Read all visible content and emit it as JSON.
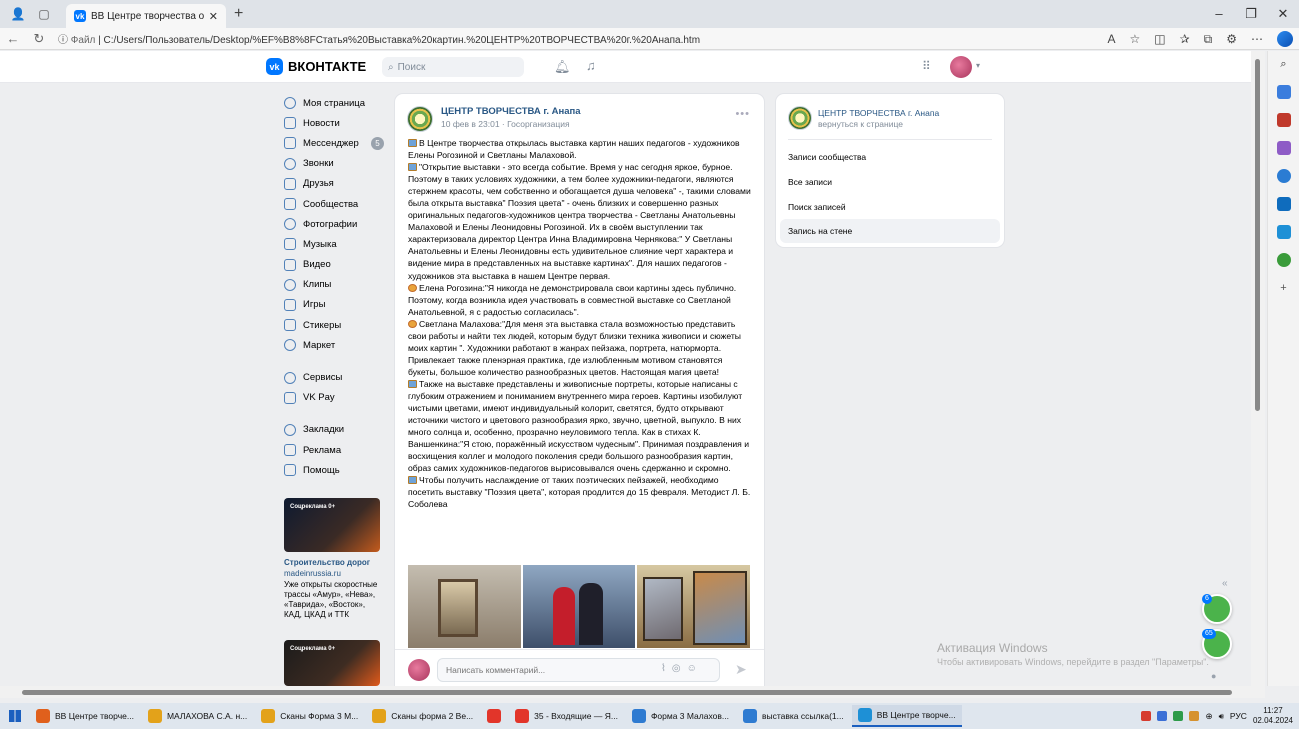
{
  "browser": {
    "tab_title": "ВВ Центре творчества откры",
    "address_label": "Файл",
    "url": "C:/Users/Пользователь/Desktop/%EF%B8%8FСтатья%20Выставка%20картин.%20ЦЕНТР%20ТВОРЧЕСТВА%20г.%20Анапа.htm"
  },
  "vk": {
    "logo_text": "ВКОНТАКТЕ",
    "search_placeholder": "Поиск"
  },
  "menu": {
    "group1": [
      {
        "label": "Моя страница",
        "icon": "user-icon"
      },
      {
        "label": "Новости",
        "icon": "news-icon"
      },
      {
        "label": "Мессенджер",
        "icon": "message-icon",
        "badge": "5"
      },
      {
        "label": "Звонки",
        "icon": "phone-icon"
      },
      {
        "label": "Друзья",
        "icon": "friends-icon"
      },
      {
        "label": "Сообщества",
        "icon": "groups-icon"
      },
      {
        "label": "Фотографии",
        "icon": "photo-icon"
      },
      {
        "label": "Музыка",
        "icon": "music-icon"
      },
      {
        "label": "Видео",
        "icon": "video-icon"
      },
      {
        "label": "Клипы",
        "icon": "clips-icon"
      },
      {
        "label": "Игры",
        "icon": "games-icon"
      },
      {
        "label": "Стикеры",
        "icon": "stickers-icon"
      },
      {
        "label": "Маркет",
        "icon": "market-icon"
      }
    ],
    "group2": [
      {
        "label": "Сервисы",
        "icon": "services-icon"
      },
      {
        "label": "VK Pay",
        "icon": "vkpay-icon"
      }
    ],
    "group3": [
      {
        "label": "Закладки",
        "icon": "bookmark-icon"
      },
      {
        "label": "Реклама",
        "icon": "ads-icon"
      },
      {
        "label": "Помощь",
        "icon": "help-icon"
      }
    ]
  },
  "ad": {
    "tag": "Соцреклама 0+",
    "title": "Строительство дорог",
    "site": "madeinrussia.ru",
    "text": "Уже открыты скоростные трассы «Амур», «Нева», «Таврида», «Восток», КАД, ЦКАД и ТТК",
    "tag2": "Соцреклама 0+"
  },
  "post": {
    "author": "ЦЕНТР ТВОРЧЕСТВА г. Анапа",
    "meta": "10 фев в 23:01 · Госорганизация",
    "paragraphs": [
      "В Центре творчества открылась выставка картин наших педагогов - художников Елены Рогозиной и Светланы Малаховой.",
      "\"Открытие выставки - это всегда событие. Время у нас сегодня яркое, бурное. Поэтому в таких условиях художники, а тем более художники-педагоги, являются стержнем красоты, чем собственно и обогащается душа человека\" -, такими словами была открыта выставка\" Поэзия цвета\" - очень близких и совершенно разных оригинальных педагогов-художников центра творчества - Светланы Анатольевны Малаховой и Елены Леонидовны Рогозиной. Их в своём выступлении так характеризовала директор Центра Инна Владимировна Чернякова:\" У Светланы Анатольевны и Елены Леонидовны есть удивительное слияние черт характера и видение мира в представленных на выставке картинах\". Для наших педагогов - художников эта выставка в нашем Центре первая.",
      "Елена Рогозина:\"Я никогда не демонстрировала свои картины здесь публично. Поэтому, когда возникла идея участвовать в совместной выставке со Светланой Анатольевной, я с радостью согласилась\".",
      "Светлана Малахова:\"Для меня эта выставка стала возможностью представить свои работы и найти тех людей, которым будут близки техника живописи и сюжеты моих картин \". Художники работают в жанрах пейзажа, портрета, натюрморта. Привлекает также пленэрная практика, где излюбленным мотивом становятся букеты, большое количество разнообразных цветов. Настоящая магия цвета!",
      "Также на выставке представлены и живописные портреты, которые написаны с глубоким отражением и пониманием внутреннего мира героев. Картины изобилуют чистыми цветами, имеют индивидуальный колорит, светятся, будто открывают источники чистого и цветового разнообразия ярко, звучно, цветной, выпукло. В них много солнца и, особенно, прозрачно неуловимого тепла. Как в стихах К. Ваншенкина:\"Я стою, поражённый искусством чудесным\". Принимая поздравления и восхищения коллег и молодого поколения среди большого разнообразия картин, образ самих художников-педагогов вырисовывался очень сдержанно и скромно.",
      "Чтобы получить наслаждение от таких поэтических пейзажей, необходимо посетить выставку \"Поэзия цвета\", которая продлится до 15 февраля. Методист Л. Б. Соболева"
    ],
    "comment_placeholder": "Написать комментарий..."
  },
  "right": {
    "name": "ЦЕНТР ТВОРЧЕСТВА г. Анапа",
    "back": "вернуться к странице",
    "items": [
      "Записи сообщества",
      "Все записи",
      "Поиск записей",
      "Запись на стене"
    ]
  },
  "watermark": {
    "line1": "Активация Windows",
    "line2": "Чтобы активировать Windows, перейдите в раздел \"Параметры\"."
  },
  "chats": [
    {
      "count": "6"
    },
    {
      "count": "65"
    }
  ],
  "taskbar": {
    "items": [
      {
        "label": "ВВ Центре творче...",
        "color": "#e0601c"
      },
      {
        "label": "МАЛАХОВА С.А. н...",
        "color": "#e3a21a"
      },
      {
        "label": "Сканы Форма 3 М...",
        "color": "#e3a21a"
      },
      {
        "label": "Сканы форма 2 Ве...",
        "color": "#e3a21a"
      },
      {
        "label": "",
        "color": "#e2352a"
      },
      {
        "label": "35 - Входящие — Я...",
        "color": "#e2352a"
      },
      {
        "label": "Форма 3 Малахов...",
        "color": "#2f7bd1"
      },
      {
        "label": "выставка ссылка(1...",
        "color": "#2f7bd1"
      },
      {
        "label": "ВВ Центре творче...",
        "color": "#1e90d6"
      }
    ],
    "lang": "РУС",
    "time": "11:27",
    "date": "02.04.2024"
  }
}
